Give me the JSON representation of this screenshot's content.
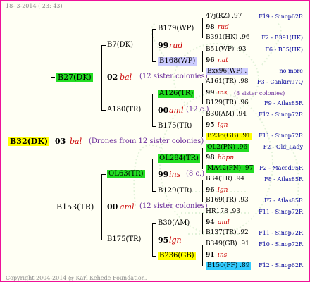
{
  "header": "18- 3-2014 ( 23: 43)",
  "copyright": "Copyright 2004-2014 @ Karl Kehede Foundation.",
  "root": {
    "name": "B32(DK)",
    "gen": "03",
    "breed": "bal",
    "note": "(Drones from 12 sister colonies)"
  },
  "dam": {
    "name": "B27(DK)",
    "gen": "02",
    "breed": "bal",
    "note": "(12 sister colonies)"
  },
  "drone": {
    "name": "B153(TR)",
    "gen": "00",
    "breed": "aml",
    "note": "(12 sister colonies)"
  },
  "b7": {
    "name": "B7(DK)",
    "gen": "99",
    "breed": "rud"
  },
  "a180": {
    "name": "A180(TR)",
    "gen": "00",
    "breed": "aml",
    "note": "(12 c.)"
  },
  "ol63": {
    "name": "OL63(TR)",
    "gen": "99",
    "breed": "ins",
    "note": "(8 c.)"
  },
  "b175": {
    "name": "B175(TR)",
    "gen": "95",
    "breed": "lgn"
  },
  "n": {
    "b179": "B179(WP)",
    "b168": "B168(WP)",
    "a126": "A126(TR)",
    "b175b": "B175(TR)",
    "ol284": "OL284(TR)",
    "b129": "B129(TR)",
    "b30": "B30(AM)",
    "b236": "B236(GB)"
  },
  "r": [
    {
      "l": "47j(RZ) .97",
      "r": "F19 - Sinop62R"
    },
    {
      "l": "98",
      "it": "rud"
    },
    {
      "l": "B391(HK) .96",
      "r": "F2 - B391(HK)"
    },
    {
      "l": "B51(WP) .93",
      "r": "F6 - B55(HK)"
    },
    {
      "l": "96",
      "it": "nat"
    },
    {
      "l": "Bxx96(WP) .",
      "r": "no more"
    },
    {
      "l": "A161(TR) .98",
      "r": "F3 - Cankiri97Q"
    },
    {
      "l": "99",
      "it": "ins",
      "n": "(8 sister colonies)"
    },
    {
      "l": "B129(TR) .96",
      "r": "F9 - Atlas85R"
    },
    {
      "l": "B30(AM) .94",
      "r": "F12 - Sinop72R"
    },
    {
      "l": "95",
      "it": "lgn"
    },
    {
      "l": "B236(GB) .91",
      "r": "F11 - Sinop72R"
    },
    {
      "l": "OL2(PN) .96",
      "r": "F2 - Old_Lady"
    },
    {
      "l": "98",
      "it": "hbpn"
    },
    {
      "l": "MA42(PN) .97",
      "r": "F2 - Maced95R"
    },
    {
      "l": "B34(TR) .94",
      "r": "F8 - Atlas85R"
    },
    {
      "l": "96",
      "it": "lgn"
    },
    {
      "l": "B169(TR) .93",
      "r": "F7 - Atlas85R"
    },
    {
      "l": "HR178 .93",
      "r": "F11 - Sinop72R"
    },
    {
      "l": "94",
      "it": "aml"
    },
    {
      "l": "B137(TR) .92",
      "r": "F11 - Sinop72R"
    },
    {
      "l": "B349(GB) .91",
      "r": "F10 - Sinop72R"
    },
    {
      "l": "91",
      "it": "ins"
    },
    {
      "l": "B150(FF) .89",
      "r": "F12 - Sinop62R"
    }
  ],
  "colors": {
    "border": "#ee1199",
    "green": "#22dd22",
    "yellow": "#ffff00",
    "blue": "#33ccff",
    "lavender": "#ccccff"
  }
}
